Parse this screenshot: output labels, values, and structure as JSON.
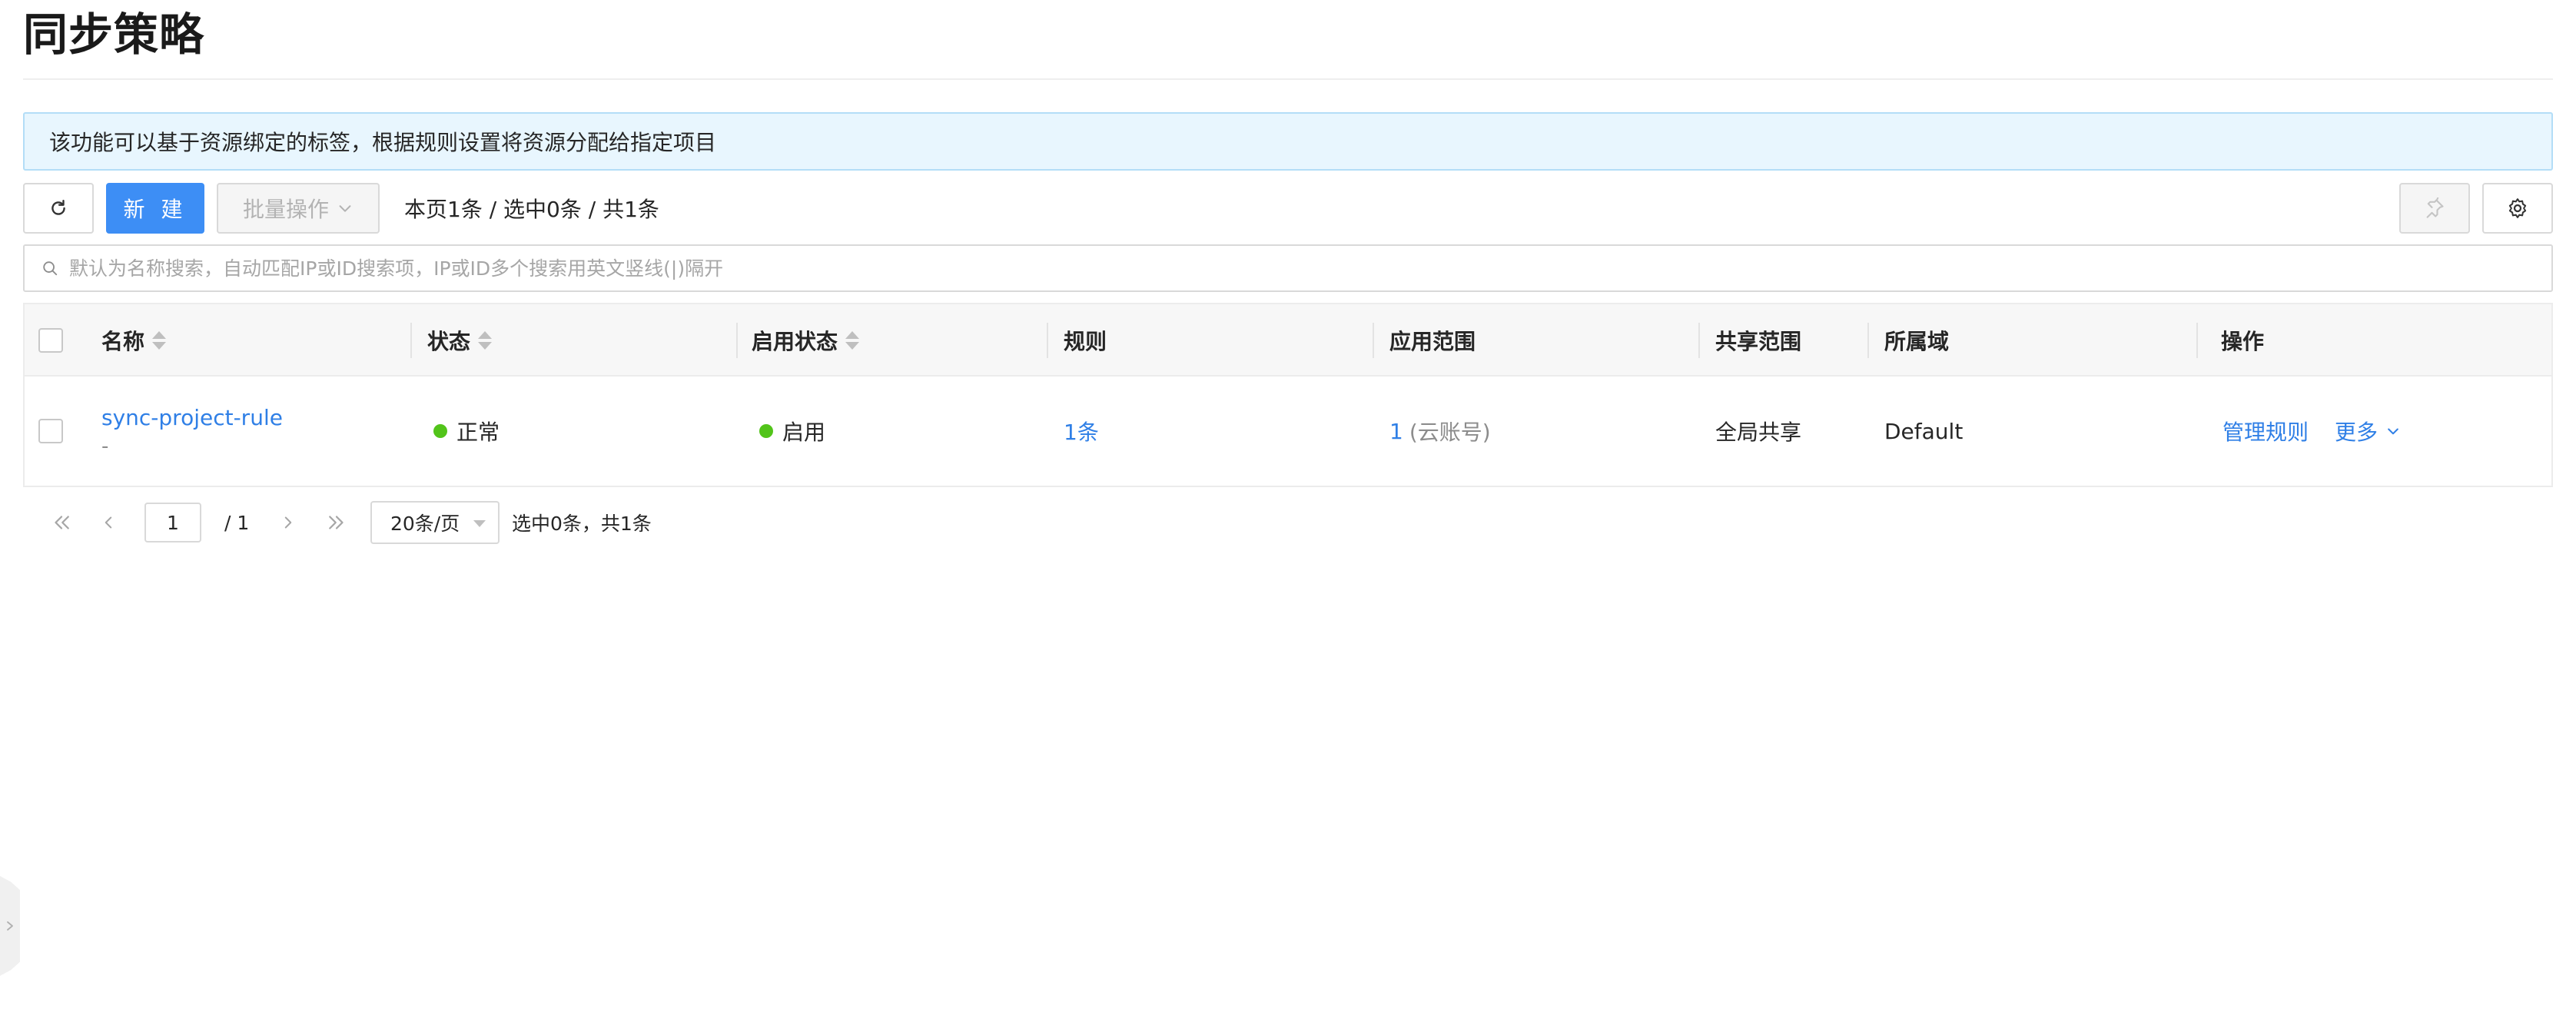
{
  "page": {
    "title": "同步策略"
  },
  "banner": {
    "text": "该功能可以基于资源绑定的标签，根据规则设置将资源分配给指定项目"
  },
  "toolbar": {
    "new_label": "新 建",
    "batch_label": "批量操作",
    "summary": "本页1条 / 选中0条 / 共1条",
    "refresh_icon": "refresh-icon",
    "pin_icon": "pin-icon",
    "settings_icon": "gear-icon"
  },
  "search": {
    "placeholder": "默认为名称搜索，自动匹配IP或ID搜索项，IP或ID多个搜索用英文竖线(|)隔开"
  },
  "table": {
    "columns": {
      "name": "名称",
      "status": "状态",
      "enabled": "启用状态",
      "rules": "规则",
      "scope": "应用范围",
      "share": "共享范围",
      "domain": "所属域",
      "actions": "操作"
    },
    "rows": [
      {
        "name": "sync-project-rule",
        "description": "-",
        "status": "正常",
        "status_color": "#52c41a",
        "enabled": "启用",
        "enabled_color": "#52c41a",
        "rules": "1条",
        "scope_count": "1",
        "scope_unit": "(云账号)",
        "share": "全局共享",
        "domain": "Default",
        "action_manage": "管理规则",
        "action_more": "更多"
      }
    ]
  },
  "pagination": {
    "current_page": "1",
    "total_pages": "/ 1",
    "page_size": "20条/页",
    "status": "选中0条，共1条"
  },
  "colors": {
    "accent": "#3d8ef5",
    "link": "#2f7fe6",
    "banner_bg": "#e8f6fe",
    "banner_border": "#b3ddf7"
  }
}
